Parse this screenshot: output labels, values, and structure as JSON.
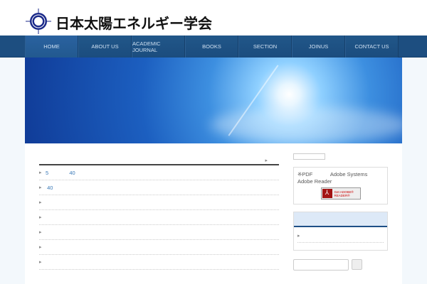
{
  "header": {
    "site_title": "日本太陽エネルギー学会",
    "accent": "#1d4e80"
  },
  "nav": {
    "items": [
      "HOME",
      "ABOUT US",
      "ACADEMIC JOURNAL",
      "BOOKS",
      "SECTION",
      "JOINUS",
      "CONTACT US"
    ]
  },
  "news": {
    "more_marker": "▸",
    "items": [
      {
        "bullet": "▸",
        "text": "5              40"
      },
      {
        "bullet": "▸",
        "text": " 40"
      },
      {
        "bullet": "▸",
        "text": ""
      },
      {
        "bullet": "▸",
        "text": ""
      },
      {
        "bullet": "▸",
        "text": ""
      },
      {
        "bullet": "▸",
        "text": ""
      },
      {
        "bullet": "▸",
        "text": ""
      }
    ]
  },
  "sidebar": {
    "pdf_text": "※PDF            Adobe Systems          Adobe Reader",
    "get_reader_label": "Get ADOBE® READER®",
    "widget_bullet": "▸"
  }
}
